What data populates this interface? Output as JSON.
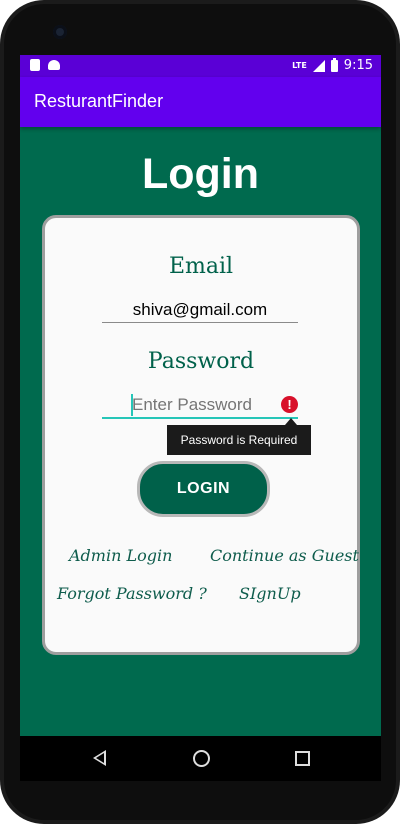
{
  "status_bar": {
    "time": "9:15",
    "network": "LTE"
  },
  "app_bar": {
    "title": "ResturantFinder"
  },
  "page": {
    "title": "Login"
  },
  "form": {
    "email_label": "Email",
    "email_value": "shiva@gmail.com",
    "password_label": "Password",
    "password_placeholder": "Enter Password",
    "password_error": "Password is Required",
    "login_button": "LOGIN"
  },
  "links": {
    "admin_login": "Admin Login",
    "continue_guest": "Continue as Guest",
    "forgot_password": "Forgot Password ?",
    "signup": "SIgnUp"
  },
  "icons": [
    "camera",
    "sim-card-icon",
    "android-icon",
    "signal-icon",
    "battery-icon",
    "error-icon",
    "back-icon",
    "home-icon",
    "recent-apps-icon"
  ],
  "colors": {
    "status_bar": "#5a00d6",
    "app_bar": "#6200ee",
    "background": "#006a4e",
    "button": "#00614a",
    "error": "#d8102a",
    "accent": "#26c6b8"
  }
}
